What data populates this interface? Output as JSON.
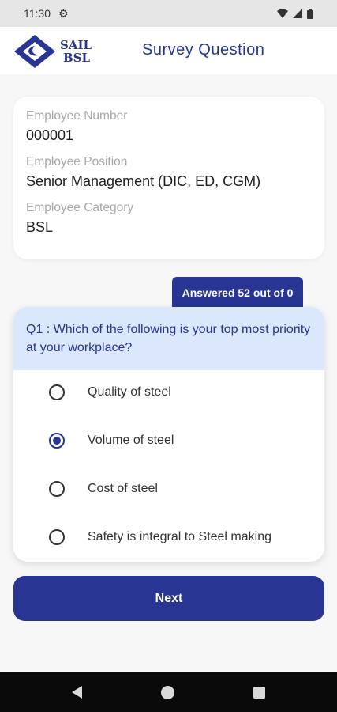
{
  "status_bar": {
    "time": "11:30"
  },
  "app_bar": {
    "logo_line1": "SAIL",
    "logo_line2": "BSL",
    "title": "Survey Question"
  },
  "employee": {
    "number_label": "Employee Number",
    "number_value": "000001",
    "position_label": "Employee Position",
    "position_value": "Senior Management (DIC, ED, CGM)",
    "category_label": "Employee Category",
    "category_value": "BSL"
  },
  "progress_badge": "Answered 52 out of 0",
  "question": {
    "text": "Q1 : Which of the following is your top most priority at your workplace?",
    "options": [
      {
        "label": "Quality of steel",
        "selected": false
      },
      {
        "label": "Volume of steel",
        "selected": true
      },
      {
        "label": "Cost of steel",
        "selected": false
      },
      {
        "label": "Safety is integral to Steel making",
        "selected": false
      }
    ]
  },
  "next_label": "Next",
  "colors": {
    "primary": "#283593",
    "question_bg": "#dbe8fb"
  }
}
